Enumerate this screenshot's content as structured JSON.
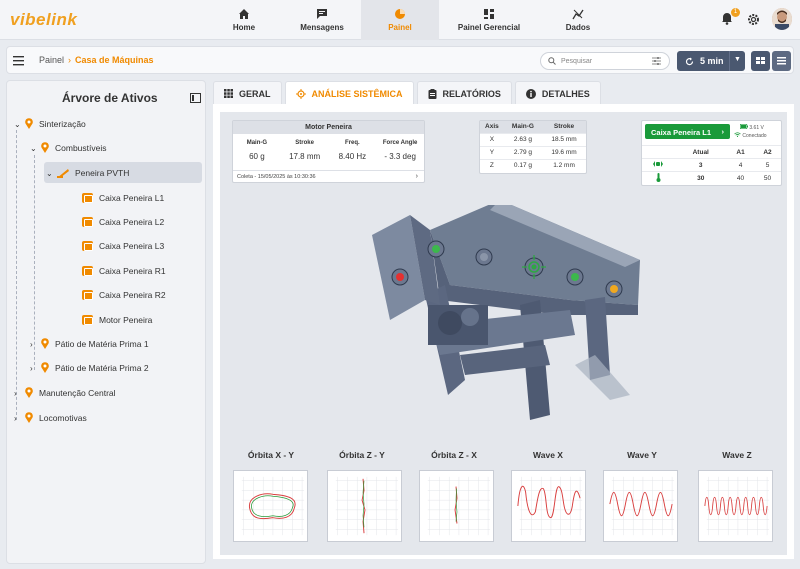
{
  "app": {
    "logo": "vibelink"
  },
  "nav": [
    {
      "label": "Home",
      "icon": "home-icon"
    },
    {
      "label": "Mensagens",
      "icon": "chat-icon"
    },
    {
      "label": "Painel",
      "icon": "pie-chart-icon",
      "active": true
    },
    {
      "label": "Painel Gerencial",
      "icon": "dashboard-icon"
    },
    {
      "label": "Dados",
      "icon": "data-icon"
    }
  ],
  "notifications": {
    "count": "1"
  },
  "breadcrumb": {
    "root": "Painel",
    "current": "Casa de Máquinas"
  },
  "search": {
    "placeholder": "Pesquisar"
  },
  "refresh": {
    "label": "5 min"
  },
  "sidebar": {
    "title": "Árvore de Ativos",
    "items": [
      {
        "label": "Sinterização"
      },
      {
        "label": "Combustíveis"
      },
      {
        "label": "Peneira PVTH"
      },
      {
        "label": "Caixa Peneira L1"
      },
      {
        "label": "Caixa Peneira L2"
      },
      {
        "label": "Caixa Peneira L3"
      },
      {
        "label": "Caixa Peneira R1"
      },
      {
        "label": "Caixa Peneira R2"
      },
      {
        "label": "Motor Peneira"
      },
      {
        "label": "Pátio de Matéria Prima 1"
      },
      {
        "label": "Pátio de Matéria Prima 2"
      },
      {
        "label": "Manutenção Central"
      },
      {
        "label": "Locomotivas"
      }
    ]
  },
  "tabs": [
    {
      "label": "GERAL"
    },
    {
      "label": "ANÁLISE SISTÊMICA",
      "active": true
    },
    {
      "label": "RELATÓRIOS"
    },
    {
      "label": "DETALHES"
    }
  ],
  "motor_card": {
    "title": "Motor Peneira",
    "metrics": [
      {
        "label": "Main-G",
        "value": "60 g"
      },
      {
        "label": "Stroke",
        "value": "17.8 mm"
      },
      {
        "label": "Freq.",
        "value": "8.40 Hz"
      },
      {
        "label": "Force Angle",
        "value": "- 3.3 deg"
      }
    ],
    "footer": "Coleta - 15/05/2025 às 10:30:36"
  },
  "axes_table": {
    "headers": [
      "Axis",
      "Main-G",
      "Stroke"
    ],
    "rows": [
      [
        "X",
        "2.63 g",
        "18.5 mm"
      ],
      [
        "Y",
        "2.79 g",
        "19.6 mm"
      ],
      [
        "Z",
        "0.17 g",
        "1.2 mm"
      ]
    ]
  },
  "caixa_card": {
    "title": "Caixa Peneira L1",
    "battery": "3.61 V",
    "status": "Conectado",
    "headers": [
      "",
      "Atual",
      "A1",
      "A2"
    ],
    "rows": [
      {
        "icon": "vibration-icon",
        "values": [
          "3",
          "4",
          "5"
        ]
      },
      {
        "icon": "thermometer-icon",
        "values": [
          "30",
          "40",
          "50"
        ]
      }
    ]
  },
  "charts": [
    {
      "title": "Órbita X - Y"
    },
    {
      "title": "Órbita Z - Y"
    },
    {
      "title": "Órbita Z - X"
    },
    {
      "title": "Wave X"
    },
    {
      "title": "Wave Y"
    },
    {
      "title": "Wave Z"
    }
  ],
  "colors": {
    "accent": "#f08a00",
    "green": "#1a9a3a",
    "dark": "#4a5870"
  }
}
